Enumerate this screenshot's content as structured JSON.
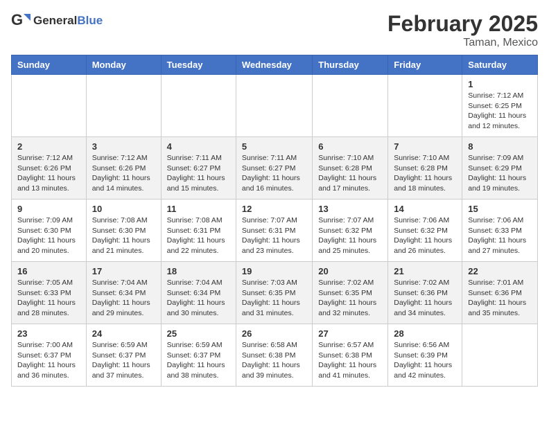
{
  "header": {
    "logo_general": "General",
    "logo_blue": "Blue",
    "month_title": "February 2025",
    "location": "Taman, Mexico"
  },
  "days_of_week": [
    "Sunday",
    "Monday",
    "Tuesday",
    "Wednesday",
    "Thursday",
    "Friday",
    "Saturday"
  ],
  "weeks": [
    {
      "days": [
        {
          "number": "",
          "info": ""
        },
        {
          "number": "",
          "info": ""
        },
        {
          "number": "",
          "info": ""
        },
        {
          "number": "",
          "info": ""
        },
        {
          "number": "",
          "info": ""
        },
        {
          "number": "",
          "info": ""
        },
        {
          "number": "1",
          "info": "Sunrise: 7:12 AM\nSunset: 6:25 PM\nDaylight: 11 hours and 12 minutes."
        }
      ]
    },
    {
      "days": [
        {
          "number": "2",
          "info": "Sunrise: 7:12 AM\nSunset: 6:26 PM\nDaylight: 11 hours and 13 minutes."
        },
        {
          "number": "3",
          "info": "Sunrise: 7:12 AM\nSunset: 6:26 PM\nDaylight: 11 hours and 14 minutes."
        },
        {
          "number": "4",
          "info": "Sunrise: 7:11 AM\nSunset: 6:27 PM\nDaylight: 11 hours and 15 minutes."
        },
        {
          "number": "5",
          "info": "Sunrise: 7:11 AM\nSunset: 6:27 PM\nDaylight: 11 hours and 16 minutes."
        },
        {
          "number": "6",
          "info": "Sunrise: 7:10 AM\nSunset: 6:28 PM\nDaylight: 11 hours and 17 minutes."
        },
        {
          "number": "7",
          "info": "Sunrise: 7:10 AM\nSunset: 6:28 PM\nDaylight: 11 hours and 18 minutes."
        },
        {
          "number": "8",
          "info": "Sunrise: 7:09 AM\nSunset: 6:29 PM\nDaylight: 11 hours and 19 minutes."
        }
      ]
    },
    {
      "days": [
        {
          "number": "9",
          "info": "Sunrise: 7:09 AM\nSunset: 6:30 PM\nDaylight: 11 hours and 20 minutes."
        },
        {
          "number": "10",
          "info": "Sunrise: 7:08 AM\nSunset: 6:30 PM\nDaylight: 11 hours and 21 minutes."
        },
        {
          "number": "11",
          "info": "Sunrise: 7:08 AM\nSunset: 6:31 PM\nDaylight: 11 hours and 22 minutes."
        },
        {
          "number": "12",
          "info": "Sunrise: 7:07 AM\nSunset: 6:31 PM\nDaylight: 11 hours and 23 minutes."
        },
        {
          "number": "13",
          "info": "Sunrise: 7:07 AM\nSunset: 6:32 PM\nDaylight: 11 hours and 25 minutes."
        },
        {
          "number": "14",
          "info": "Sunrise: 7:06 AM\nSunset: 6:32 PM\nDaylight: 11 hours and 26 minutes."
        },
        {
          "number": "15",
          "info": "Sunrise: 7:06 AM\nSunset: 6:33 PM\nDaylight: 11 hours and 27 minutes."
        }
      ]
    },
    {
      "days": [
        {
          "number": "16",
          "info": "Sunrise: 7:05 AM\nSunset: 6:33 PM\nDaylight: 11 hours and 28 minutes."
        },
        {
          "number": "17",
          "info": "Sunrise: 7:04 AM\nSunset: 6:34 PM\nDaylight: 11 hours and 29 minutes."
        },
        {
          "number": "18",
          "info": "Sunrise: 7:04 AM\nSunset: 6:34 PM\nDaylight: 11 hours and 30 minutes."
        },
        {
          "number": "19",
          "info": "Sunrise: 7:03 AM\nSunset: 6:35 PM\nDaylight: 11 hours and 31 minutes."
        },
        {
          "number": "20",
          "info": "Sunrise: 7:02 AM\nSunset: 6:35 PM\nDaylight: 11 hours and 32 minutes."
        },
        {
          "number": "21",
          "info": "Sunrise: 7:02 AM\nSunset: 6:36 PM\nDaylight: 11 hours and 34 minutes."
        },
        {
          "number": "22",
          "info": "Sunrise: 7:01 AM\nSunset: 6:36 PM\nDaylight: 11 hours and 35 minutes."
        }
      ]
    },
    {
      "days": [
        {
          "number": "23",
          "info": "Sunrise: 7:00 AM\nSunset: 6:37 PM\nDaylight: 11 hours and 36 minutes."
        },
        {
          "number": "24",
          "info": "Sunrise: 6:59 AM\nSunset: 6:37 PM\nDaylight: 11 hours and 37 minutes."
        },
        {
          "number": "25",
          "info": "Sunrise: 6:59 AM\nSunset: 6:37 PM\nDaylight: 11 hours and 38 minutes."
        },
        {
          "number": "26",
          "info": "Sunrise: 6:58 AM\nSunset: 6:38 PM\nDaylight: 11 hours and 39 minutes."
        },
        {
          "number": "27",
          "info": "Sunrise: 6:57 AM\nSunset: 6:38 PM\nDaylight: 11 hours and 41 minutes."
        },
        {
          "number": "28",
          "info": "Sunrise: 6:56 AM\nSunset: 6:39 PM\nDaylight: 11 hours and 42 minutes."
        },
        {
          "number": "",
          "info": ""
        }
      ]
    }
  ]
}
